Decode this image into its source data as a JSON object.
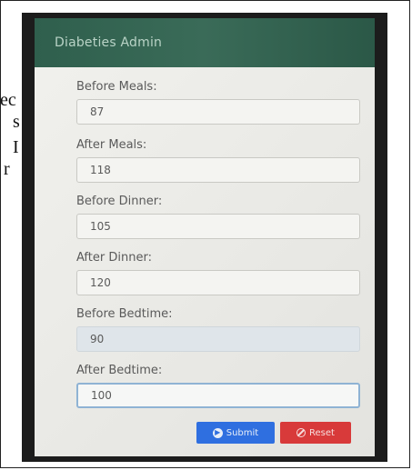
{
  "background_text": [
    "ec",
    "s",
    "I",
    "r"
  ],
  "app": {
    "title": "Diabeties Admin"
  },
  "form": {
    "fields": [
      {
        "label": "Before Meals:",
        "value": "87"
      },
      {
        "label": "After Meals:",
        "value": "118"
      },
      {
        "label": "Before Dinner:",
        "value": "105"
      },
      {
        "label": "After Dinner:",
        "value": "120"
      },
      {
        "label": "Before Bedtime:",
        "value": "90"
      },
      {
        "label": "After Bedtime:",
        "value": "100"
      }
    ],
    "submit_label": "Submit",
    "reset_label": "Reset"
  },
  "colors": {
    "header": "#2f5f4d",
    "submit": "#2f6fe0",
    "reset": "#d83a3a"
  },
  "icons": {
    "submit": "arrow-circle-icon",
    "reset": "ban-icon"
  }
}
